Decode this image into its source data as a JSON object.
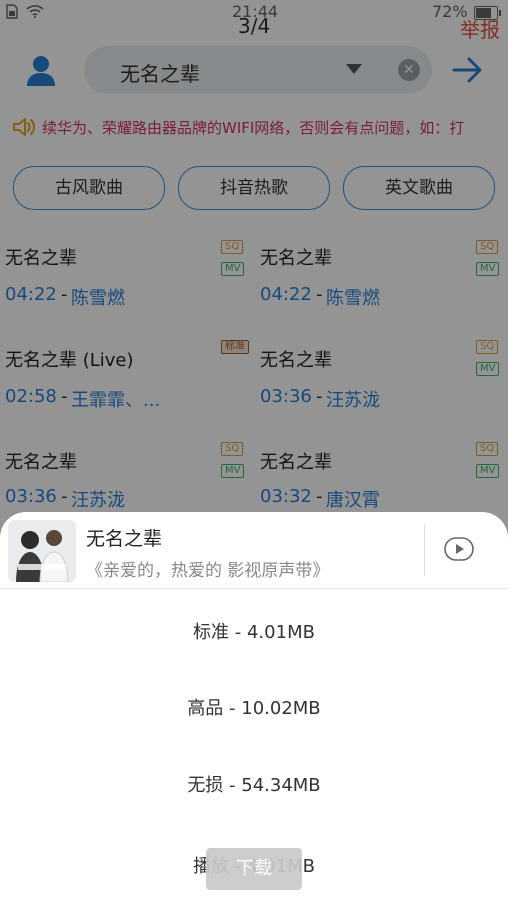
{
  "status_bar": {
    "time": "21:44",
    "battery_percent": "72%"
  },
  "header": {
    "page_indicator": "3/4",
    "report_label": "举报"
  },
  "search": {
    "query": "无名之辈",
    "clear_icon": "close-circle-icon"
  },
  "marquee": {
    "text": "续华为、荣耀路由器品牌的WIFI网络，否则会有点问题，如：打"
  },
  "categories": [
    {
      "label": "古风歌曲"
    },
    {
      "label": "抖音热歌"
    },
    {
      "label": "英文歌曲"
    }
  ],
  "songs": [
    {
      "title": "无名之辈",
      "duration": "04:22",
      "artist": "陈雪燃",
      "tags": [
        "SQ",
        "MV"
      ]
    },
    {
      "title": "无名之辈",
      "duration": "04:22",
      "artist": "陈雪燃",
      "tags": [
        "SQ",
        "MV"
      ]
    },
    {
      "title": "无名之辈 (Live)",
      "duration": "02:58",
      "artist": "王霏霏、...",
      "tags": [
        "标准"
      ]
    },
    {
      "title": "无名之辈",
      "duration": "03:36",
      "artist": "汪苏泷",
      "tags": [
        "SQ",
        "MV"
      ]
    },
    {
      "title": "无名之辈",
      "duration": "03:36",
      "artist": "汪苏泷",
      "tags": [
        "SQ",
        "MV"
      ]
    },
    {
      "title": "无名之辈",
      "duration": "03:32",
      "artist": "唐汉霄",
      "tags": [
        "SQ",
        "MV"
      ]
    }
  ],
  "sheet": {
    "title": "无名之辈",
    "album": "《亲爱的，热爱的 影视原声带》",
    "options": [
      {
        "label": "标准 - 4.01MB"
      },
      {
        "label": "高品 - 10.02MB"
      },
      {
        "label": "无损 - 54.34MB"
      },
      {
        "label": "播放 - 4.01MB"
      }
    ],
    "download_label": "下载"
  },
  "colors": {
    "accent": "#2a7fd6",
    "report": "#e74c3c",
    "marquee": "#d0336b"
  }
}
